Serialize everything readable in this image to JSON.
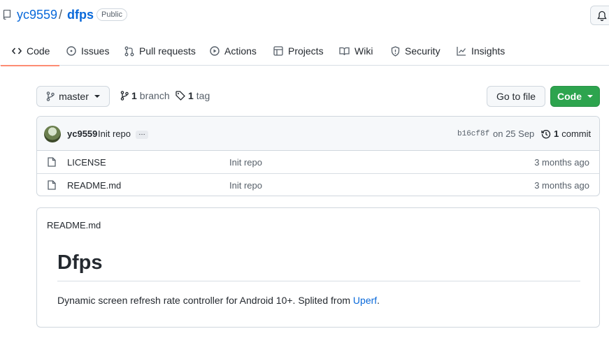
{
  "repo": {
    "owner": "yc9559",
    "separator": "/",
    "name": "dfps",
    "visibility": "Public"
  },
  "tabs": [
    {
      "label": "Code",
      "icon": "code-icon",
      "active": true
    },
    {
      "label": "Issues",
      "icon": "issue-icon"
    },
    {
      "label": "Pull requests",
      "icon": "pull-request-icon"
    },
    {
      "label": "Actions",
      "icon": "actions-play-icon"
    },
    {
      "label": "Projects",
      "icon": "projects-table-icon"
    },
    {
      "label": "Wiki",
      "icon": "book-icon"
    },
    {
      "label": "Security",
      "icon": "shield-icon"
    },
    {
      "label": "Insights",
      "icon": "graph-icon"
    }
  ],
  "branch_bar": {
    "branch": "master",
    "branch_count": "1",
    "branch_word": "branch",
    "tag_count": "1",
    "tag_word": "tag",
    "go_to_file": "Go to file",
    "code_button": "Code"
  },
  "commit": {
    "author": "yc9559",
    "message": "Init repo",
    "ellipsis": "…",
    "sha": "b16cf8f",
    "date": "on 25 Sep",
    "count": "1",
    "count_word": "commit"
  },
  "files": [
    {
      "name": "LICENSE",
      "message": "Init repo",
      "age": "3 months ago"
    },
    {
      "name": "README.md",
      "message": "Init repo",
      "age": "3 months ago"
    }
  ],
  "readme": {
    "filename": "README.md",
    "heading": "Dfps",
    "text_before_link": "Dynamic screen refresh rate controller for Android 10+. Splited from ",
    "link_text": "Uperf",
    "text_after_link": "."
  },
  "colors": {
    "link": "#0969da",
    "code_button": "#2da44e",
    "active_tab_underline": "#fd8c73"
  }
}
